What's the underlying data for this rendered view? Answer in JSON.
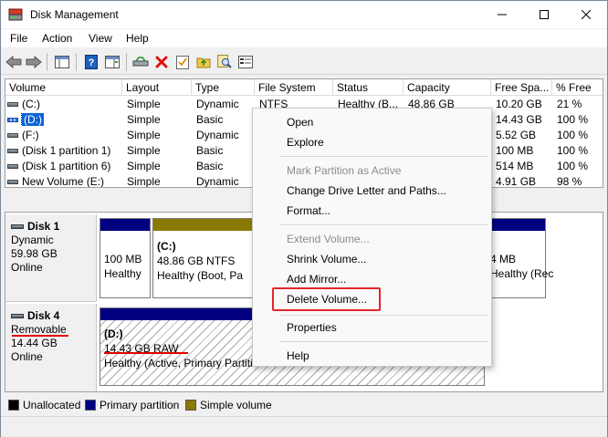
{
  "window": {
    "title": "Disk Management"
  },
  "menu": {
    "file": "File",
    "action": "Action",
    "view": "View",
    "help": "Help"
  },
  "volume_list": {
    "columns": [
      "Volume",
      "Layout",
      "Type",
      "File System",
      "Status",
      "Capacity",
      "Free Spa...",
      "% Free"
    ],
    "rows": [
      {
        "volume": "(C:)",
        "layout": "Simple",
        "type": "Dynamic",
        "fs": "NTFS",
        "status": "Healthy (B...",
        "capacity": "48.86 GB",
        "free": "10.20 GB",
        "pct": "21 %"
      },
      {
        "volume": "(D:)",
        "layout": "Simple",
        "type": "Basic",
        "fs": "",
        "status": "",
        "capacity": "",
        "free": "14.43 GB",
        "pct": "100 %"
      },
      {
        "volume": "(F:)",
        "layout": "Simple",
        "type": "Dynamic",
        "fs": "",
        "status": "",
        "capacity": "",
        "free": "5.52 GB",
        "pct": "100 %"
      },
      {
        "volume": "(Disk 1 partition 1)",
        "layout": "Simple",
        "type": "Basic",
        "fs": "",
        "status": "",
        "capacity": "",
        "free": "100 MB",
        "pct": "100 %"
      },
      {
        "volume": "(Disk 1 partition 6)",
        "layout": "Simple",
        "type": "Basic",
        "fs": "",
        "status": "",
        "capacity": "",
        "free": "514 MB",
        "pct": "100 %"
      },
      {
        "volume": "New Volume (E:)",
        "layout": "Simple",
        "type": "Dynamic",
        "fs": "",
        "status": "",
        "capacity": "",
        "free": "4.91 GB",
        "pct": "98 %"
      }
    ]
  },
  "disks": {
    "disk1": {
      "name": "Disk 1",
      "type": "Dynamic",
      "size": "59.98 GB",
      "status": "Online",
      "partitions": [
        {
          "size": "100 MB",
          "status": "Healthy"
        },
        {
          "name": "(C:)",
          "size": "48.86 GB NTFS",
          "status": "Healthy (Boot, Pa"
        },
        {
          "size": "4 MB",
          "status": "Healthy (Rec"
        }
      ]
    },
    "disk4": {
      "name": "Disk 4",
      "type": "Removable",
      "size": "14.44 GB",
      "status": "Online",
      "partition": {
        "name": "(D:)",
        "size": "14.43 GB RAW",
        "status": "Healthy (Active, Primary Partiti"
      }
    }
  },
  "legend": {
    "unallocated": "Unallocated",
    "primary": "Primary partition",
    "simple": "Simple volume"
  },
  "context_menu": {
    "open": "Open",
    "explore": "Explore",
    "mark_active": "Mark Partition as Active",
    "change_letter": "Change Drive Letter and Paths...",
    "format": "Format...",
    "extend": "Extend Volume...",
    "shrink": "Shrink Volume...",
    "add_mirror": "Add Mirror...",
    "delete": "Delete Volume...",
    "properties": "Properties",
    "help": "Help"
  },
  "colors": {
    "primary_partition": "#000080",
    "simple_volume": "#8b7a00",
    "unallocated": "#000000",
    "highlight": "#e3262b",
    "selection": "#0a64d6"
  }
}
